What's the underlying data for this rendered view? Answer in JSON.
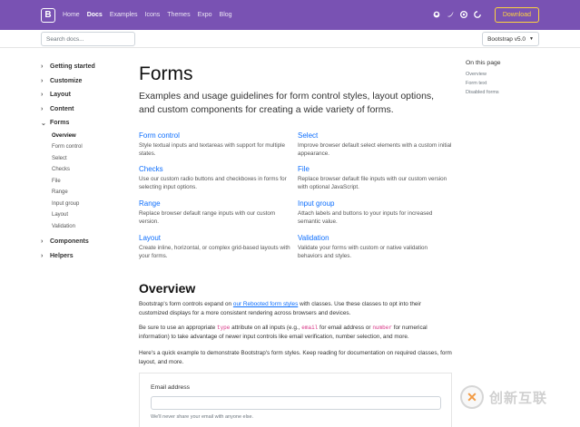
{
  "navbar": {
    "brand": "B",
    "links": [
      "Home",
      "Docs",
      "Examples",
      "Icons",
      "Themes",
      "Expo",
      "Blog"
    ],
    "active": "Docs",
    "icons": [
      "github-icon",
      "twitter-icon",
      "opencollective-icon",
      "slack-icon"
    ],
    "download_label": "Download",
    "accent": "#7952b3",
    "download_color": "#ffd33d"
  },
  "subnav": {
    "search_placeholder": "Search docs...",
    "version_label": "Bootstrap v5.0"
  },
  "sidebar": {
    "groups_top": [
      "Getting started",
      "Customize",
      "Layout",
      "Content"
    ],
    "forms_group": "Forms",
    "forms_items": [
      "Overview",
      "Form control",
      "Select",
      "Checks",
      "File",
      "Range",
      "Input group",
      "Layout",
      "Validation"
    ],
    "active_item": "Overview",
    "groups_bottom": [
      "Components",
      "Helpers"
    ]
  },
  "main": {
    "title": "Forms",
    "lead": "Examples and usage guidelines for form control styles, layout options, and custom components for creating a wide variety of forms.",
    "cards": [
      {
        "title": "Form control",
        "desc": "Style textual inputs and textareas with support for multiple states."
      },
      {
        "title": "Select",
        "desc": "Improve browser default select elements with a custom initial appearance."
      },
      {
        "title": "Checks",
        "desc": "Use our custom radio buttons and checkboxes in forms for selecting input options."
      },
      {
        "title": "File",
        "desc": "Replace browser default file inputs with our custom version with optional JavaScript."
      },
      {
        "title": "Range",
        "desc": "Replace browser default range inputs with our custom version."
      },
      {
        "title": "Input group",
        "desc": "Attach labels and buttons to your inputs for increased semantic value."
      },
      {
        "title": "Layout",
        "desc": "Create inline, horizontal, or complex grid-based layouts with your forms."
      },
      {
        "title": "Validation",
        "desc": "Validate your forms with custom or native validation behaviors and styles."
      }
    ],
    "overview_title": "Overview",
    "p1_a": "Bootstrap's form controls expand on ",
    "p1_link": "our Rebooted form styles",
    "p1_b": " with classes. Use these classes to opt into their customized displays for a more consistent rendering across browsers and devices.",
    "p2_a": "Be sure to use an appropriate ",
    "p2_code1": "type",
    "p2_b": " attribute on all inputs (e.g., ",
    "p2_code2": "email",
    "p2_c": " for email address or ",
    "p2_code3": "number",
    "p2_d": " for numerical information) to take advantage of newer input controls like email verification, number selection, and more.",
    "p3": "Here's a quick example to demonstrate Bootstrap's form styles. Keep reading for documentation on required classes, form layout, and more.",
    "email_label": "Email address",
    "email_help": "We'll never share your email with anyone else."
  },
  "toc": {
    "title": "On this page",
    "items": [
      "Overview",
      "Form text",
      "Disabled forms"
    ]
  },
  "watermark": {
    "text": "创新互联"
  }
}
